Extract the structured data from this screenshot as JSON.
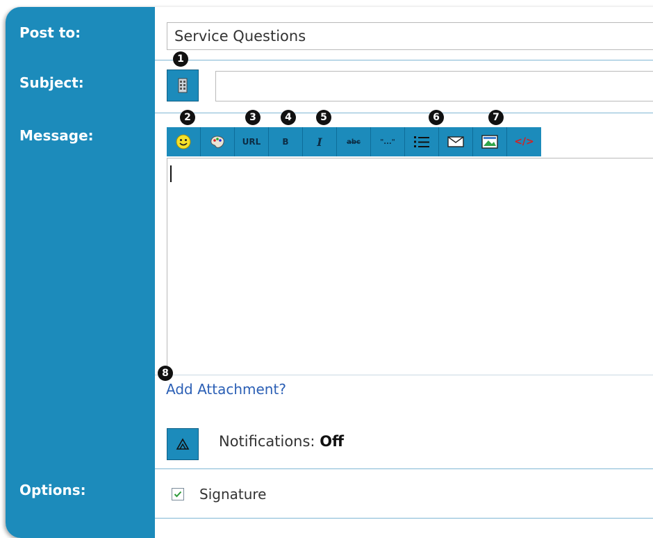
{
  "form": {
    "labels": {
      "post_to": "Post to:",
      "subject": "Subject:",
      "message": "Message:",
      "options": "Options:"
    },
    "post_to": {
      "value": "Service Questions"
    },
    "subject": {
      "value": "",
      "icon": "subject-icon"
    },
    "toolbar": [
      {
        "name": "smiley-icon",
        "text": ""
      },
      {
        "name": "palette-icon",
        "text": ""
      },
      {
        "name": "url-button",
        "text": "URL"
      },
      {
        "name": "bold-button",
        "text": "B"
      },
      {
        "name": "italic-button",
        "text": "I"
      },
      {
        "name": "strikethrough-button",
        "text": "abc"
      },
      {
        "name": "quote-button",
        "text": "\"...\""
      },
      {
        "name": "list-icon",
        "text": ""
      },
      {
        "name": "email-icon",
        "text": ""
      },
      {
        "name": "image-icon",
        "text": ""
      },
      {
        "name": "code-button",
        "text": "</>"
      }
    ],
    "add_attachment": "Add Attachment?",
    "notifications": {
      "label": "Notifications:",
      "value": "Off"
    },
    "signature": {
      "label": "Signature",
      "checked": true
    }
  },
  "badges": [
    "1",
    "2",
    "3",
    "4",
    "5",
    "6",
    "7",
    "8"
  ],
  "colors": {
    "sidebar": "#1c8bbb",
    "link": "#2b5fb5",
    "code_red": "#d62020"
  }
}
